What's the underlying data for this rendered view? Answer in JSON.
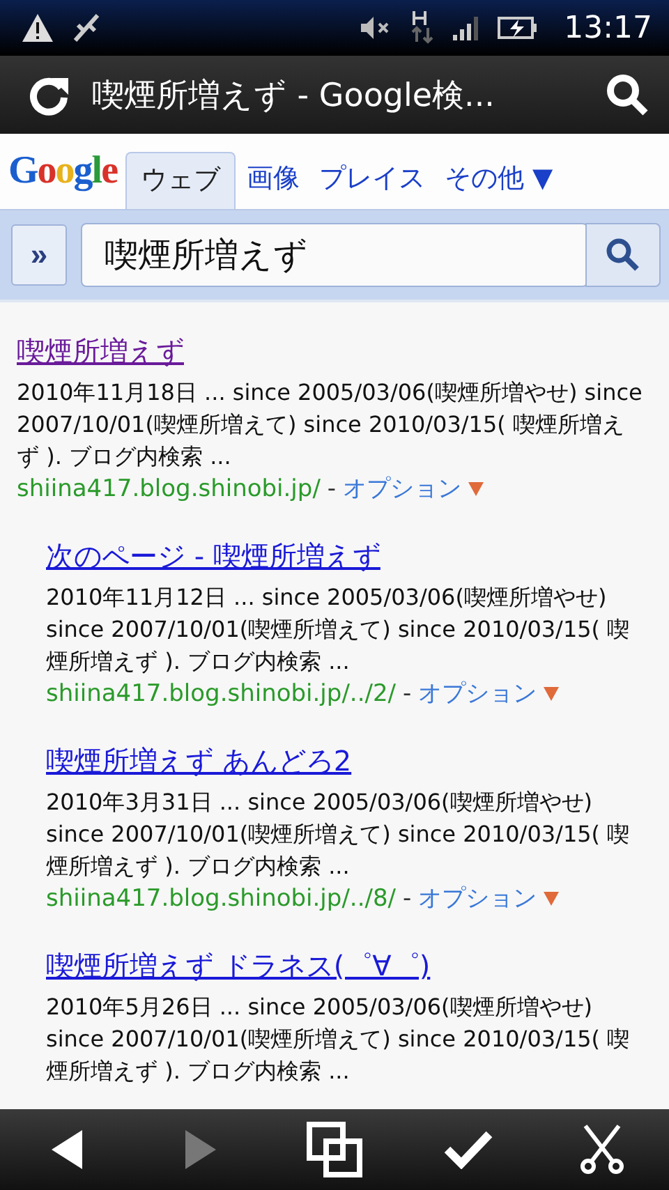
{
  "status_bar": {
    "time": "13:17"
  },
  "title_bar": {
    "title": "喫煙所増えず - Google検..."
  },
  "google_header": {
    "logo": "Google",
    "tabs": [
      {
        "label": "ウェブ",
        "selected": true
      },
      {
        "label": "画像",
        "selected": false
      },
      {
        "label": "プレイス",
        "selected": false
      },
      {
        "label": "その他 ▼",
        "selected": false
      }
    ]
  },
  "search": {
    "expand": "»",
    "value": "喫煙所増えず"
  },
  "results": [
    {
      "title": "喫煙所増えず",
      "visited": true,
      "snippet": "2010年11月18日 ... since 2005/03/06(喫煙所増やせ) since 2007/10/01(喫煙所増えて) since 2010/03/15( 喫煙所増えず ). ブログ内検索 ...",
      "url": "shiina417.blog.shinobi.jp/",
      "separator": "-",
      "options": "オプション",
      "children": [
        {
          "title": "次のページ - 喫煙所増えず",
          "visited": false,
          "snippet": "2010年11月12日 ... since 2005/03/06(喫煙所増やせ) since 2007/10/01(喫煙所増えて) since 2010/03/15( 喫煙所増えず ). ブログ内検索 ...",
          "url": "shiina417.blog.shinobi.jp/../2/",
          "separator": "-",
          "options": "オプション"
        },
        {
          "title": "喫煙所増えず あんどろ2",
          "visited": false,
          "snippet": "2010年3月31日 ... since 2005/03/06(喫煙所増やせ) since 2007/10/01(喫煙所増えて) since 2010/03/15( 喫煙所増えず ). ブログ内検索 ...",
          "url": "shiina417.blog.shinobi.jp/../8/",
          "separator": "-",
          "options": "オプション"
        },
        {
          "title": "喫煙所増えず ドラネス(゜∀゜)",
          "visited": false,
          "snippet": "2010年5月26日 ... since 2005/03/06(喫煙所増やせ) since 2007/10/01(喫煙所増えて) since 2010/03/15( 喫煙所増えず ). ブログ内検索 ..."
        }
      ]
    }
  ],
  "toolbar": [
    {
      "kind": "back",
      "enabled": true
    },
    {
      "kind": "forward",
      "enabled": false
    },
    {
      "kind": "windows",
      "enabled": true
    },
    {
      "kind": "check",
      "enabled": true
    },
    {
      "kind": "cut",
      "enabled": true
    }
  ]
}
